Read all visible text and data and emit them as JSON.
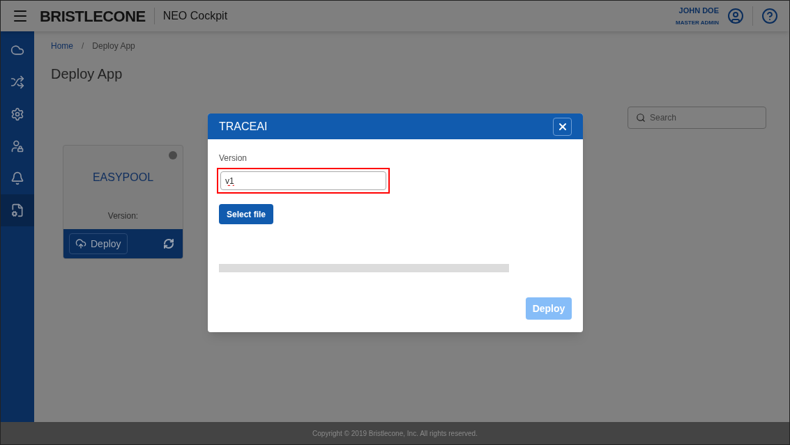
{
  "header": {
    "brand": "BRISTLECONE",
    "app_name": "NEO Cockpit",
    "user_name": "JOHN DOE",
    "user_role": "MASTER ADMIN"
  },
  "sidebar": {
    "items": [
      {
        "kind": "cloud",
        "selected": false
      },
      {
        "kind": "flows",
        "selected": false
      },
      {
        "kind": "gear",
        "selected": false
      },
      {
        "kind": "user-lock",
        "selected": false
      },
      {
        "kind": "bell",
        "selected": false
      },
      {
        "kind": "deploy",
        "selected": true
      }
    ]
  },
  "breadcrumb": [
    {
      "label": "Home",
      "current": false
    },
    {
      "label": "Deploy App",
      "current": true
    }
  ],
  "breadcrumb_separator": "/",
  "page_title": "Deploy App",
  "search": {
    "placeholder": "Search"
  },
  "cards": [
    {
      "title": "EASYPOOL",
      "color": "#4a4a4a",
      "version_label": "Version:",
      "deploy_label": "Deploy"
    }
  ],
  "dialog": {
    "title": "TRACEAI",
    "version_label": "Version",
    "version_value": "v1",
    "highlighted": true,
    "select_label": "Select file",
    "progress": {
      "level": 0
    },
    "deploy_label": "Deploy",
    "deploy_disabled": true
  },
  "footer": "Copyright © 2019 Bristlecone, Inc. All rights reserved."
}
